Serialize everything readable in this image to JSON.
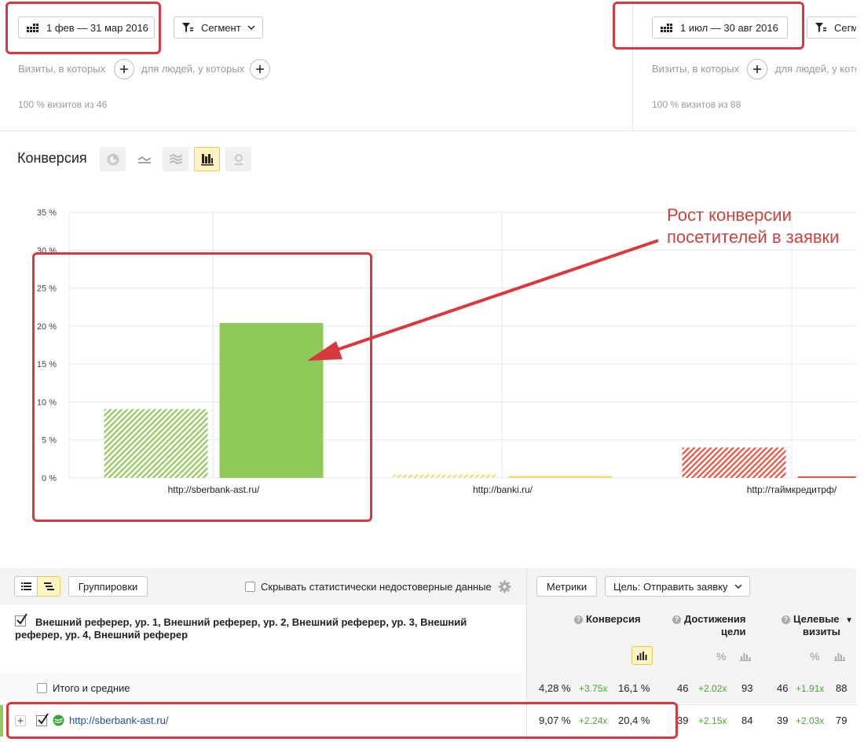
{
  "segments": [
    {
      "date_range": "1 фев — 31 мар 2016",
      "segment_label": "Сегмент",
      "visits_label": "Визиты, в которых",
      "people_label": "для людей, у которых",
      "summary": "100 % визитов из 46"
    },
    {
      "date_range": "1 июл — 30 авг 2016",
      "segment_label": "Сегмент",
      "visits_label": "Визиты, в которых",
      "people_label": "для людей, у которых",
      "summary": "100 % визитов из 88"
    }
  ],
  "chart_header": {
    "title": "Конверсия",
    "views": [
      "pie-icon",
      "line-icon",
      "area-icon",
      "bar-icon",
      "map-icon"
    ],
    "active_view": "bar-icon"
  },
  "annotation": {
    "line1": "Рост конверсии",
    "line2": "посетителей в заявки"
  },
  "chart_data": {
    "type": "bar",
    "categories": [
      "http://sberbank-ast.ru/",
      "http://banki.ru/",
      "http://таймкредитрф/"
    ],
    "series": [
      {
        "style": "hatched",
        "values": [
          9.07,
          0.45,
          4.0
        ]
      },
      {
        "style": "solid",
        "values": [
          20.4,
          0.25,
          0.2
        ]
      }
    ],
    "category_colors": [
      "#8ec95a",
      "#f5d96b",
      "#e8533d"
    ],
    "ylim": [
      0,
      35
    ],
    "yticks": [
      "0 %",
      "5 %",
      "10 %",
      "15 %",
      "20 %",
      "25 %",
      "30 %",
      "35 %"
    ],
    "grid": true
  },
  "toolbar": {
    "groupings_label": "Группировки",
    "hide_unreliable_label": "Скрывать статистически недостоверные данные",
    "metrics_label": "Метрики",
    "goal_label": "Цель: Отправить заявку"
  },
  "table": {
    "dimensions_header": "Внешний реферер, ур. 1, Внешний реферер, ур. 2, Внешний реферер, ур. 3, Внешний реферер, ур. 4, Внешний реферер",
    "columns": [
      {
        "title": "Конверсия"
      },
      {
        "title_line1": "Достижения",
        "title_line2": "цели"
      },
      {
        "title_line1": "Целевые",
        "title_line2": "визиты"
      }
    ],
    "pct_symbol": "%",
    "totals": {
      "label": "Итого и средние",
      "conv_a": "4,28 %",
      "conv_ratio": "+3.75x",
      "conv_b": "16,1 %",
      "goal_a": "46",
      "goal_ratio": "+2.02x",
      "goal_b": "93",
      "visits_a": "46",
      "visits_ratio": "+1.91x",
      "visits_b": "88"
    },
    "rows": [
      {
        "label": "http://sberbank-ast.ru/",
        "conv_a": "9,07 %",
        "conv_ratio": "+2.24x",
        "conv_b": "20,4 %",
        "goal_a": "39",
        "goal_ratio": "+2.15x",
        "goal_b": "84",
        "visits_a": "39",
        "visits_ratio": "+2.03x",
        "visits_b": "79"
      }
    ]
  }
}
